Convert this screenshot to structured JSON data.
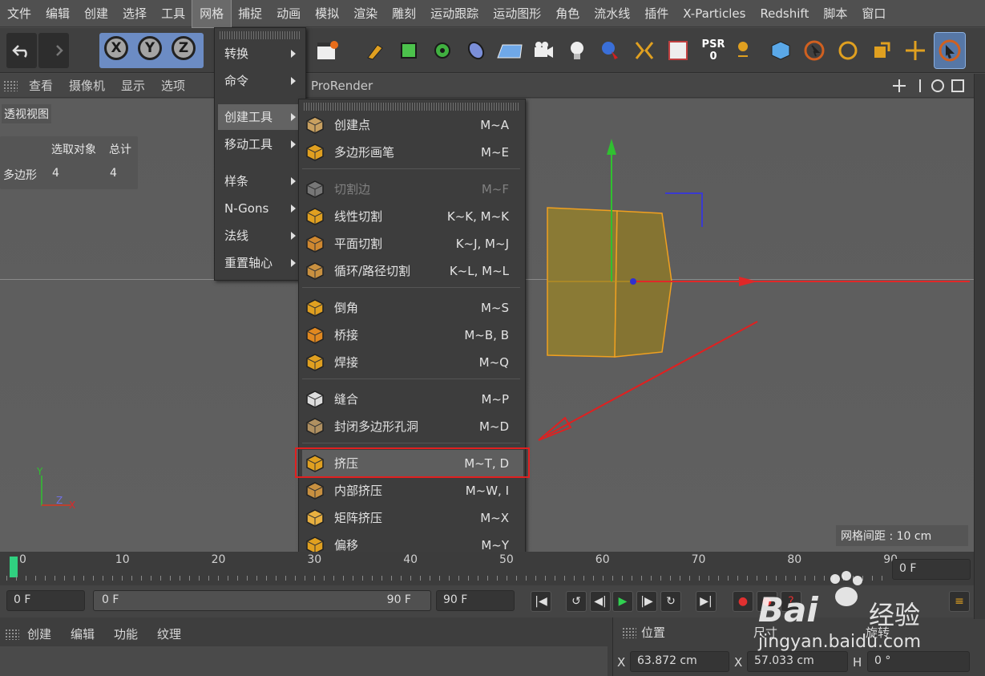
{
  "menubar": {
    "items": [
      "文件",
      "编辑",
      "创建",
      "选择",
      "工具",
      "网格",
      "捕捉",
      "动画",
      "模拟",
      "渲染",
      "雕刻",
      "运动跟踪",
      "运动图形",
      "角色",
      "流水线",
      "插件",
      "X-Particles",
      "Redshift",
      "脚本",
      "窗口"
    ],
    "active_index": 5
  },
  "toolbar": {
    "x_label": "X",
    "y_label": "Y",
    "z_label": "Z",
    "psr_label": "PSR",
    "psr_value": "0"
  },
  "viewport_bar": {
    "items": [
      "查看",
      "摄像机",
      "显示",
      "选项"
    ],
    "renderer": "ProRender"
  },
  "viewport": {
    "view_label": "透视视图",
    "stats": {
      "header_selected": "选取对象",
      "header_total": "总计",
      "row_label": "多边形",
      "selected": "4",
      "total": "4"
    },
    "grid_spacing": "网格间距 : 10 cm",
    "axis_x": "X",
    "axis_y": "Y",
    "axis_z": "Z"
  },
  "mesh_menu": {
    "items": [
      {
        "label": "转换",
        "has_submenu": true
      },
      {
        "label": "命令",
        "has_submenu": true
      },
      {
        "label": "创建工具",
        "has_submenu": true,
        "highlighted": true
      },
      {
        "label": "移动工具",
        "has_submenu": true
      },
      {
        "label": "样条",
        "has_submenu": true
      },
      {
        "label": "N-Gons",
        "has_submenu": true
      },
      {
        "label": "法线",
        "has_submenu": true
      },
      {
        "label": "重置轴心",
        "has_submenu": true
      }
    ]
  },
  "create_tools_menu": {
    "items": [
      {
        "label": "创建点",
        "shortcut": "M~A",
        "icon": "create-point-icon"
      },
      {
        "label": "多边形画笔",
        "shortcut": "M~E",
        "icon": "polygon-pen-icon"
      },
      {
        "label": "切割边",
        "shortcut": "M~F",
        "icon": "edge-cut-icon",
        "disabled": true
      },
      {
        "label": "线性切割",
        "shortcut": "K~K, M~K",
        "icon": "knife-icon"
      },
      {
        "label": "平面切割",
        "shortcut": "K~J, M~J",
        "icon": "plane-cut-icon"
      },
      {
        "label": "循环/路径切割",
        "shortcut": "K~L, M~L",
        "icon": "loop-cut-icon"
      },
      {
        "label": "倒角",
        "shortcut": "M~S",
        "icon": "bevel-icon"
      },
      {
        "label": "桥接",
        "shortcut": "M~B, B",
        "icon": "bridge-icon"
      },
      {
        "label": "焊接",
        "shortcut": "M~Q",
        "icon": "weld-icon"
      },
      {
        "label": "缝合",
        "shortcut": "M~P",
        "icon": "stitch-icon"
      },
      {
        "label": "封闭多边形孔洞",
        "shortcut": "M~D",
        "icon": "close-hole-icon"
      },
      {
        "label": "挤压",
        "shortcut": "M~T, D",
        "icon": "extrude-icon",
        "highlighted": true
      },
      {
        "label": "内部挤压",
        "shortcut": "M~W, I",
        "icon": "extrude-inner-icon"
      },
      {
        "label": "矩阵挤压",
        "shortcut": "M~X",
        "icon": "matrix-extrude-icon"
      },
      {
        "label": "偏移",
        "shortcut": "M~Y",
        "icon": "offset-icon"
      }
    ]
  },
  "timeline": {
    "ticks": [
      "0",
      "10",
      "20",
      "30",
      "40",
      "50",
      "60",
      "70",
      "80",
      "90"
    ],
    "current_frame": "0 F"
  },
  "controls": {
    "start_frame": "0 F",
    "range_start": "0 F",
    "range_end": "90 F",
    "end_frame": "90 F"
  },
  "bottom_panel": {
    "menu": [
      "创建",
      "编辑",
      "功能",
      "纹理"
    ],
    "coords_title": "位置",
    "size_title": "尺寸",
    "rot_title": "旋转",
    "x_label": "X",
    "x_value": "63.872 cm",
    "x2_label": "X",
    "x2_value": "57.033 cm",
    "h_label": "H",
    "h_value": "0 °"
  },
  "watermark": {
    "brand": "Bai",
    "brand2": "经验",
    "url": "jingyan.baidu.com"
  },
  "colors": {
    "accent_red": "#e02020",
    "mesh_orange": "#f0a020",
    "axis_x": "#e02828",
    "axis_y": "#30c030",
    "axis_z": "#3a3ad0"
  }
}
